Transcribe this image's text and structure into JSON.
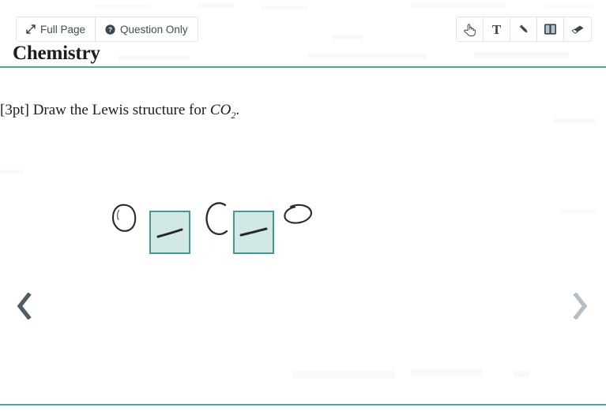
{
  "view_controls": [
    {
      "id": "full-page",
      "label": "Full Page",
      "icon": "expand-arrows-icon"
    },
    {
      "id": "question-only",
      "label": "Question Only",
      "icon": "question-circle-icon"
    }
  ],
  "tools": [
    {
      "id": "select",
      "icon": "pointing-hand-icon",
      "glyph": "",
      "title": "Select"
    },
    {
      "id": "text",
      "icon": "text-icon",
      "glyph": "T",
      "title": "Text"
    },
    {
      "id": "pencil",
      "icon": "pencil-icon",
      "glyph": "",
      "title": "Pencil"
    },
    {
      "id": "split",
      "icon": "split-columns-icon",
      "glyph": "",
      "title": "Split view"
    },
    {
      "id": "eraser",
      "icon": "eraser-icon",
      "glyph": "",
      "title": "Eraser"
    }
  ],
  "page": {
    "title": "Chemistry"
  },
  "question": {
    "points_label": "[3pt]",
    "prompt": "Draw the Lewis structure for",
    "formula_base": "CO",
    "formula_sub": "2",
    "terminator": "."
  },
  "answer": {
    "description": "Handwritten Lewis structure: O — C — O",
    "marks": [
      {
        "id": "o-left",
        "kind": "letter",
        "value": "O",
        "highlighted": false
      },
      {
        "id": "bond-1",
        "kind": "bond-dash",
        "value": "—",
        "highlighted": true
      },
      {
        "id": "c-center",
        "kind": "letter",
        "value": "C",
        "highlighted": false
      },
      {
        "id": "bond-2",
        "kind": "bond-dash",
        "value": "—",
        "highlighted": true
      },
      {
        "id": "o-right",
        "kind": "letter",
        "value": "O",
        "highlighted": false
      }
    ]
  },
  "navigation": {
    "prev_label": "‹",
    "prev_icon": "chevron-left-icon",
    "prev_enabled": "true",
    "next_label": "›",
    "next_icon": "chevron-right-icon",
    "next_enabled": "false"
  },
  "colors": {
    "accent_teal": "#4aa8a0",
    "highlight_fill": "#d2e8e5",
    "highlight_border": "#3f9b96",
    "icon_slate": "#37474f",
    "nav_active": "#4e5d66",
    "nav_disabled": "#b3bec6"
  }
}
